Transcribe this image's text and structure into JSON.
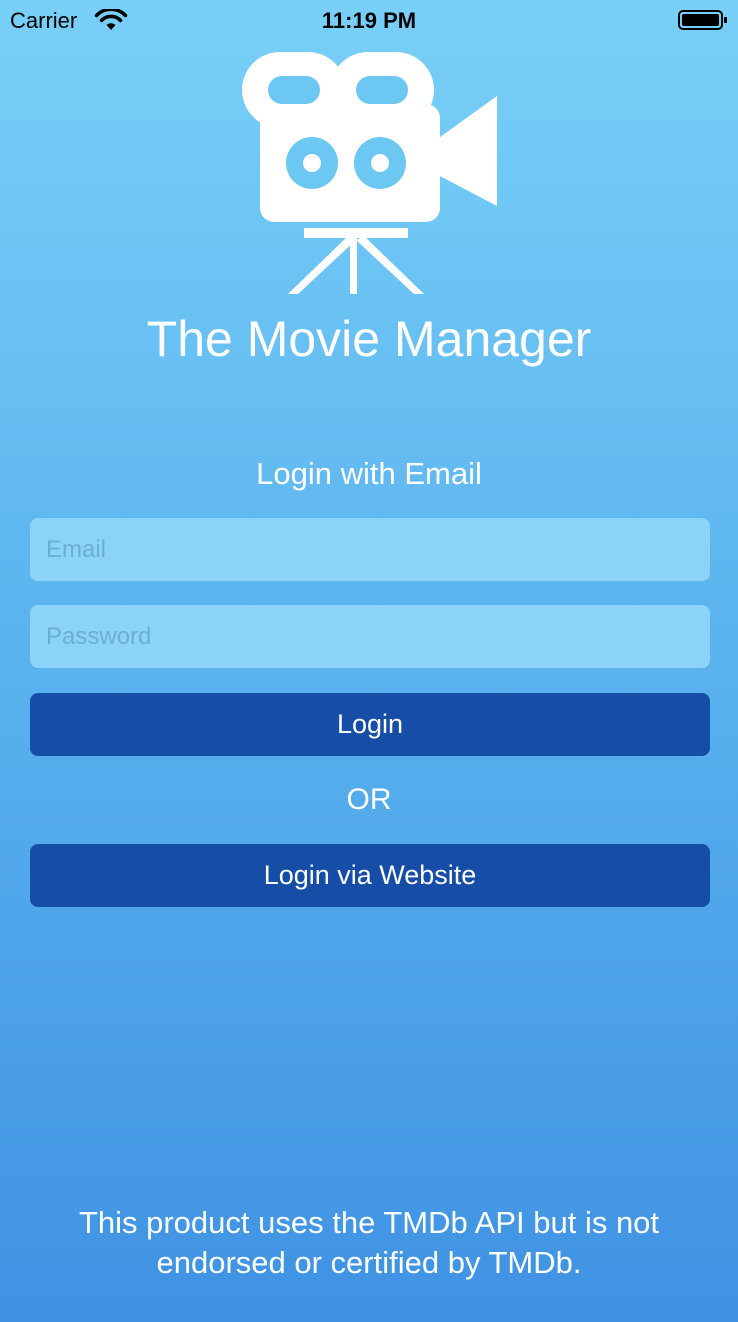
{
  "status_bar": {
    "carrier": "Carrier",
    "time": "11:19 PM",
    "icons": [
      "wifi-icon",
      "battery-icon"
    ]
  },
  "app": {
    "logo_icon": "movie-camera-icon",
    "title": "The Movie Manager"
  },
  "login": {
    "heading": "Login with Email",
    "email_placeholder": "Email",
    "email_value": "",
    "password_placeholder": "Password",
    "password_value": "",
    "login_button_label": "Login",
    "or_label": "OR",
    "website_button_label": "Login via Website"
  },
  "footer": {
    "disclaimer": "This product uses the TMDb API but is not endorsed or certified by TMDb."
  },
  "colors": {
    "background_top": "#78d0f8",
    "background_bottom": "#3f92e2",
    "field_bg": "#8bd3f9",
    "button_bg": "#164ea7",
    "text": "#ffffff"
  }
}
